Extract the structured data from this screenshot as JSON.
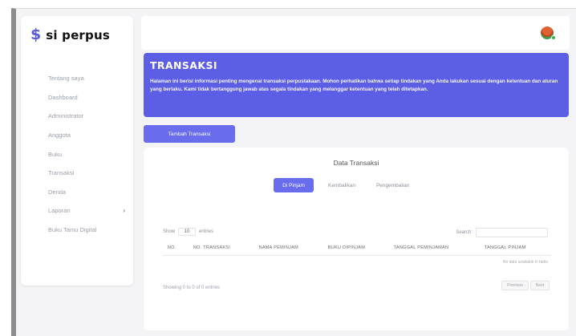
{
  "app": {
    "logo_icon": "dollar-icon",
    "logo_mark": "$",
    "name": "si perpus"
  },
  "sidebar": {
    "items": [
      {
        "label": "Tentang saya",
        "icon": ""
      },
      {
        "label": "Dashboard",
        "icon": ""
      },
      {
        "label": "Administrator",
        "icon": ""
      },
      {
        "label": "Anggota",
        "icon": ""
      },
      {
        "label": "Buku",
        "icon": ""
      },
      {
        "label": "Transaksi",
        "icon": ""
      },
      {
        "label": "Denda",
        "icon": ""
      },
      {
        "label": "Laporan",
        "caret": "›"
      },
      {
        "label": "Buku Tamu Digital",
        "icon": ""
      }
    ]
  },
  "header": {
    "avatar_icon": "user-avatar"
  },
  "banner": {
    "title": "TRANSAKSI",
    "text": "Halaman ini berisi informasi penting mengenai transaksi perpustakaan. Mohon perhatikan bahwa setiap tindakan yang Anda lakukan sesuai dengan ketentuan dan aturan yang berlaku. Kami tidak bertanggung jawab atas segala tindakan yang melanggar ketentuan yang telah ditetapkan."
  },
  "actions": {
    "new_label": "Tambah Transaksi"
  },
  "card": {
    "title": "Data Transaksi",
    "tabs": [
      "Di Pinjam",
      "Kembalikan",
      "Pengembalian"
    ],
    "active_tab": 0,
    "show_label": "Show",
    "show_value": "10",
    "entries_label": "entries",
    "search_label": "Search:",
    "search_value": "",
    "columns": [
      "No.",
      "No. Transaksi",
      "Nama Peminjam",
      "Buku Dipinjam",
      "Tanggal Peminjaman",
      "Tanggal Pinjam"
    ],
    "empty_text": "No data available in table",
    "info": "Showing 0 to 0 of 0 entries",
    "previous_label": "Previous",
    "next_label": "Next"
  },
  "colors": {
    "accent": "#5c5ee6",
    "button": "#6a6cee",
    "background": "#f4f4f6"
  }
}
